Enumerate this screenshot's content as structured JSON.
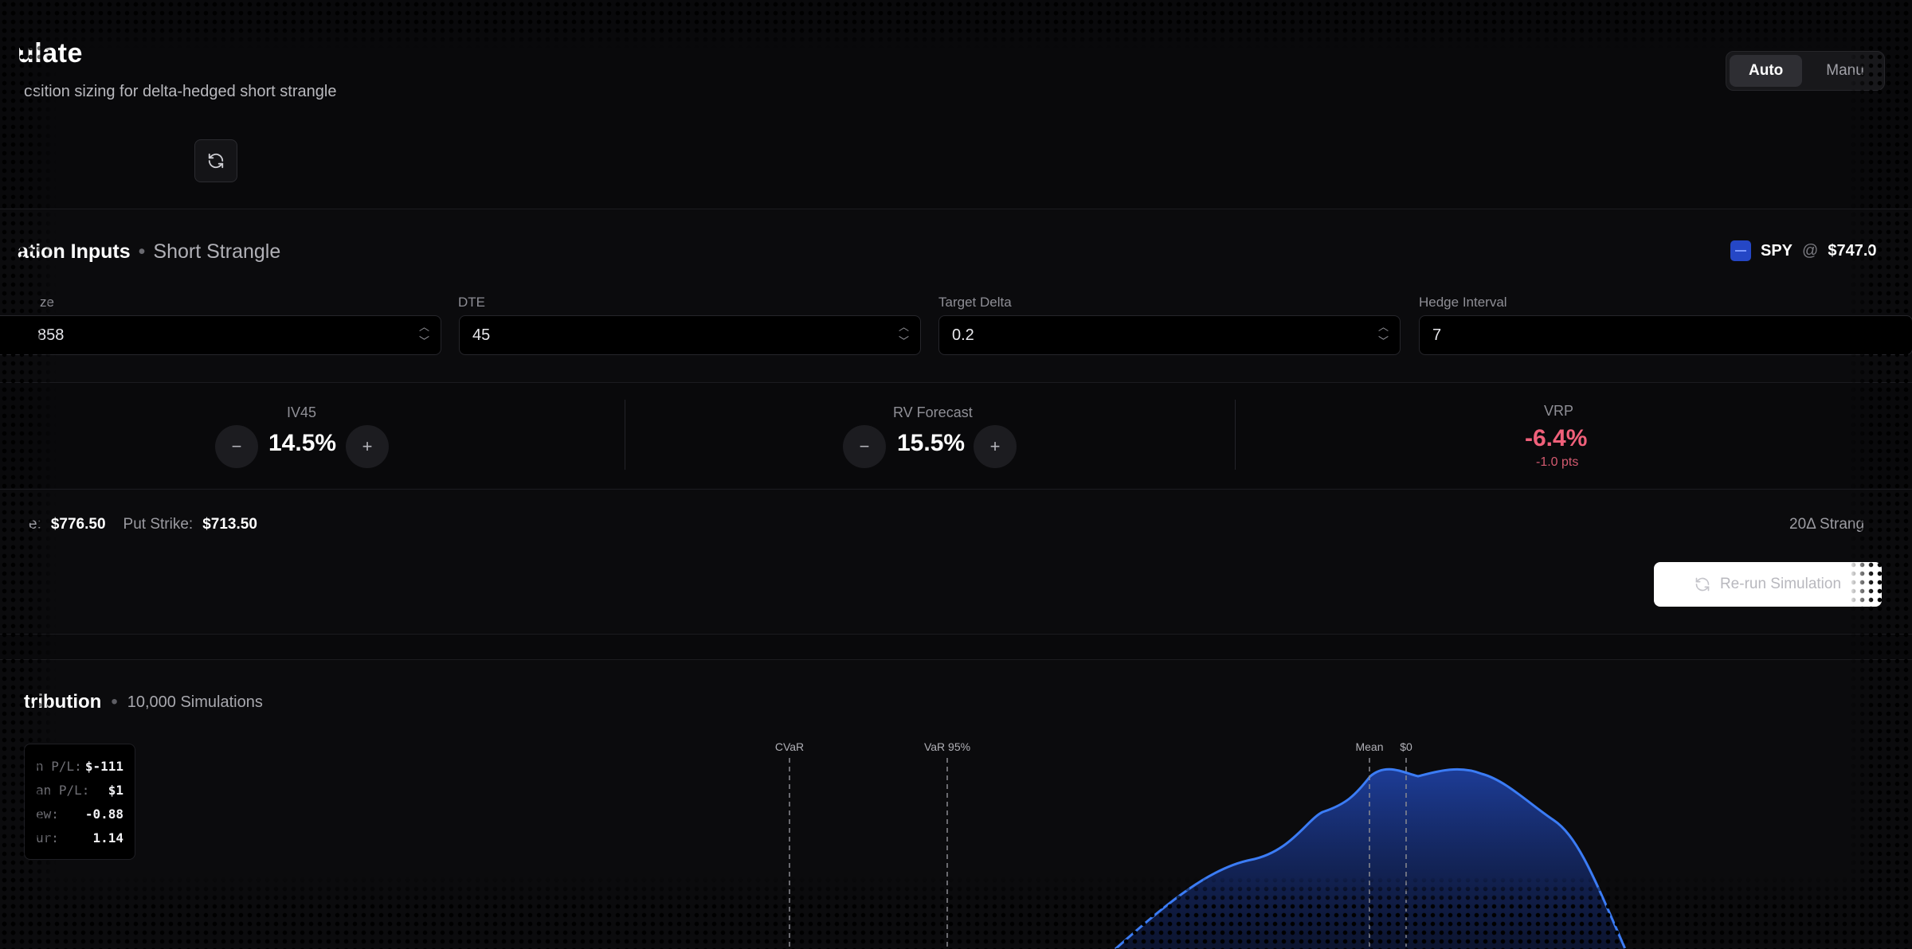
{
  "header": {
    "title": "ulate",
    "subtitle": "osition sizing for delta-hedged short strangle",
    "mode_options": [
      "Auto",
      "Manu"
    ],
    "active_mode": "Auto"
  },
  "inputs": {
    "title": "ation Inputs",
    "subtitle": "Short Strangle",
    "ticker": {
      "symbol": "SPY",
      "at": "@",
      "price": "$747.0"
    },
    "fields": [
      {
        "label": "ze",
        "value": "858"
      },
      {
        "label": "DTE",
        "value": "45"
      },
      {
        "label": "Target Delta",
        "value": "0.2"
      },
      {
        "label": "Hedge Interval",
        "value": "7"
      }
    ]
  },
  "vol": {
    "iv_label": "IV45",
    "iv_value": "14.5%",
    "rv_label": "RV Forecast",
    "rv_value": "15.5%",
    "vrp_label": "VRP",
    "vrp_value": "-6.4%",
    "vrp_sub": "-1.0 pts",
    "colors": {
      "negative": "#f0607a"
    }
  },
  "strikes": {
    "call_label": "e:",
    "call_value": "$776.50",
    "put_label": "Put Strike:",
    "put_value": "$713.50",
    "tag": "20Δ Strang",
    "rerun_label": "Re-run Simulation"
  },
  "distribution": {
    "title": "tribution",
    "subtitle": "10,000 Simulations",
    "stats": [
      {
        "key": "n P/L:",
        "value": "$-111"
      },
      {
        "key": "an P/L:",
        "value": "$1"
      },
      {
        "key": "ew:",
        "value": "-0.88"
      },
      {
        "key": "ur:",
        "value": "1.14"
      }
    ],
    "markers": [
      {
        "label": "CVaR"
      },
      {
        "label": "VaR 95%"
      },
      {
        "label": "Mean"
      },
      {
        "label": "$0"
      }
    ],
    "colors": {
      "curve": "#3b7cf5",
      "fill_top": "#1e3f9e"
    }
  }
}
